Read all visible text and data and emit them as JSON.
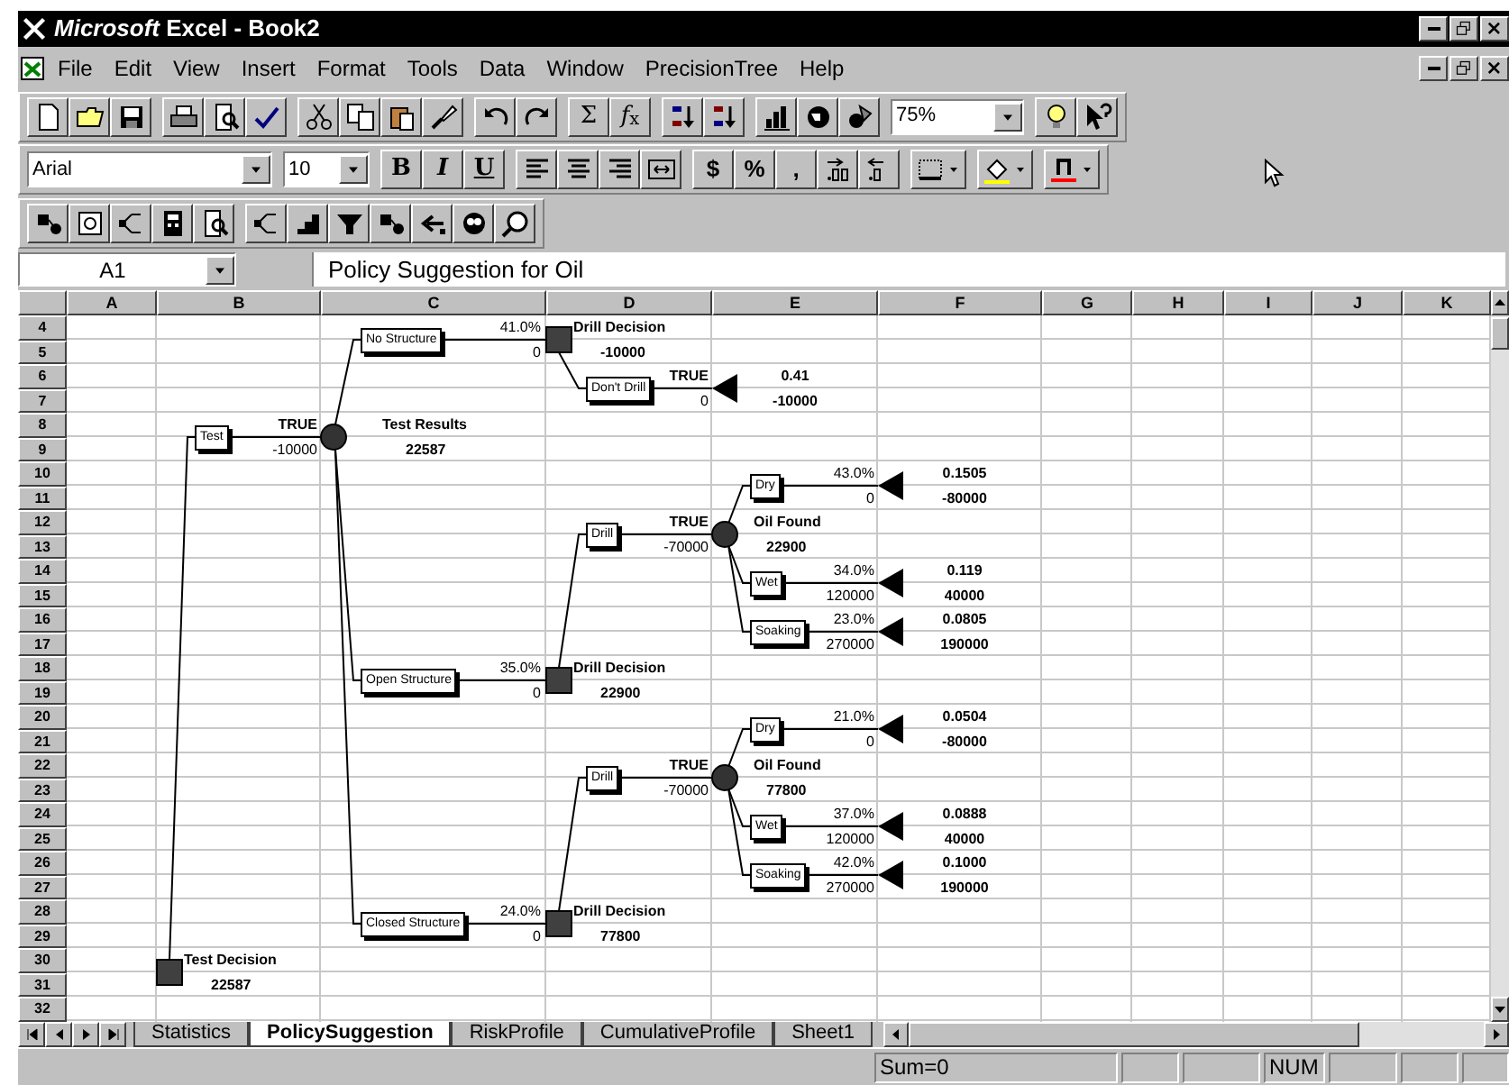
{
  "window": {
    "title": "*Microsoft* Excel - Book2"
  },
  "menu": [
    "File",
    "Edit",
    "View",
    "Insert",
    "Format",
    "Tools",
    "Data",
    "Window",
    "PrecisionTree",
    "Help"
  ],
  "standard_toolbar": {
    "sum_button": "Σ",
    "function_button": "*f*$_{x}$",
    "zoom": "75%"
  },
  "formatting_toolbar": {
    "font": "Arial",
    "font_size": "10",
    "style_buttons": [
      "B",
      "I",
      "U"
    ],
    "number_buttons": [
      "$",
      "%",
      ","
    ]
  },
  "formula_bar": {
    "name_box": "A1",
    "content": "Policy Suggestion for Oil"
  },
  "sheet": {
    "columns": [
      "A",
      "B",
      "C",
      "D",
      "E",
      "F",
      "G",
      "H",
      "I",
      "J",
      "K"
    ],
    "rows": [
      "4",
      "5",
      "6",
      "7",
      "8",
      "9",
      "10",
      "11",
      "12",
      "13",
      "14",
      "15",
      "16",
      "17",
      "18",
      "19",
      "20",
      "21",
      "22",
      "23",
      "24",
      "25",
      "26",
      "27",
      "28",
      "29",
      "30",
      "31",
      "32"
    ]
  },
  "decision_tree": {
    "root": {
      "title": "Test Decision",
      "value": "22587"
    },
    "test_branch": {
      "label": "Test",
      "flag": "TRUE",
      "cost": "-10000"
    },
    "test_node": {
      "title": "Test Results",
      "value": "22587"
    },
    "outcomes": [
      {
        "label": "No Structure",
        "probability": "41.0%",
        "payoff": "0",
        "decision": {
          "title": "Drill Decision",
          "value": "-10000"
        },
        "choice": {
          "kind": "terminal",
          "label": "Don't Drill",
          "flag": "TRUE",
          "cost": "0",
          "end": {
            "probability": "0.41",
            "value": "-10000"
          }
        }
      },
      {
        "label": "Open Structure",
        "probability": "35.0%",
        "payoff": "0",
        "decision": {
          "title": "Drill Decision",
          "value": "22900"
        },
        "choice": {
          "kind": "chance",
          "label": "Drill",
          "flag": "TRUE",
          "cost": "-70000",
          "node": {
            "title": "Oil Found",
            "value": "22900"
          },
          "results": [
            {
              "label": "Dry",
              "probability": "43.0%",
              "payoff": "0",
              "end": {
                "probability": "0.1505",
                "value": "-80000"
              }
            },
            {
              "label": "Wet",
              "probability": "34.0%",
              "payoff": "120000",
              "end": {
                "probability": "0.119",
                "value": "40000"
              }
            },
            {
              "label": "Soaking",
              "probability": "23.0%",
              "payoff": "270000",
              "end": {
                "probability": "0.0805",
                "value": "190000"
              }
            }
          ]
        }
      },
      {
        "label": "Closed Structure",
        "probability": "24.0%",
        "payoff": "0",
        "decision": {
          "title": "Drill Decision",
          "value": "77800"
        },
        "choice": {
          "kind": "chance",
          "label": "Drill",
          "flag": "TRUE",
          "cost": "-70000",
          "node": {
            "title": "Oil Found",
            "value": "77800"
          },
          "results": [
            {
              "label": "Dry",
              "probability": "21.0%",
              "payoff": "0",
              "end": {
                "probability": "0.0504",
                "value": "-80000"
              }
            },
            {
              "label": "Wet",
              "probability": "37.0%",
              "payoff": "120000",
              "end": {
                "probability": "0.0888",
                "value": "40000"
              }
            },
            {
              "label": "Soaking",
              "probability": "42.0%",
              "payoff": "270000",
              "end": {
                "probability": "0.1000",
                "value": "190000"
              }
            }
          ]
        }
      }
    ]
  },
  "sheet_tabs": [
    {
      "label": "Statistics",
      "selected": false
    },
    {
      "label": "PolicySuggestion",
      "selected": true
    },
    {
      "label": "RiskProfile",
      "selected": false
    },
    {
      "label": "CumulativeProfile",
      "selected": false
    },
    {
      "label": "Sheet1",
      "selected": false
    }
  ],
  "status_bar": {
    "sum": "Sum=0",
    "num_lock": "NUM"
  }
}
